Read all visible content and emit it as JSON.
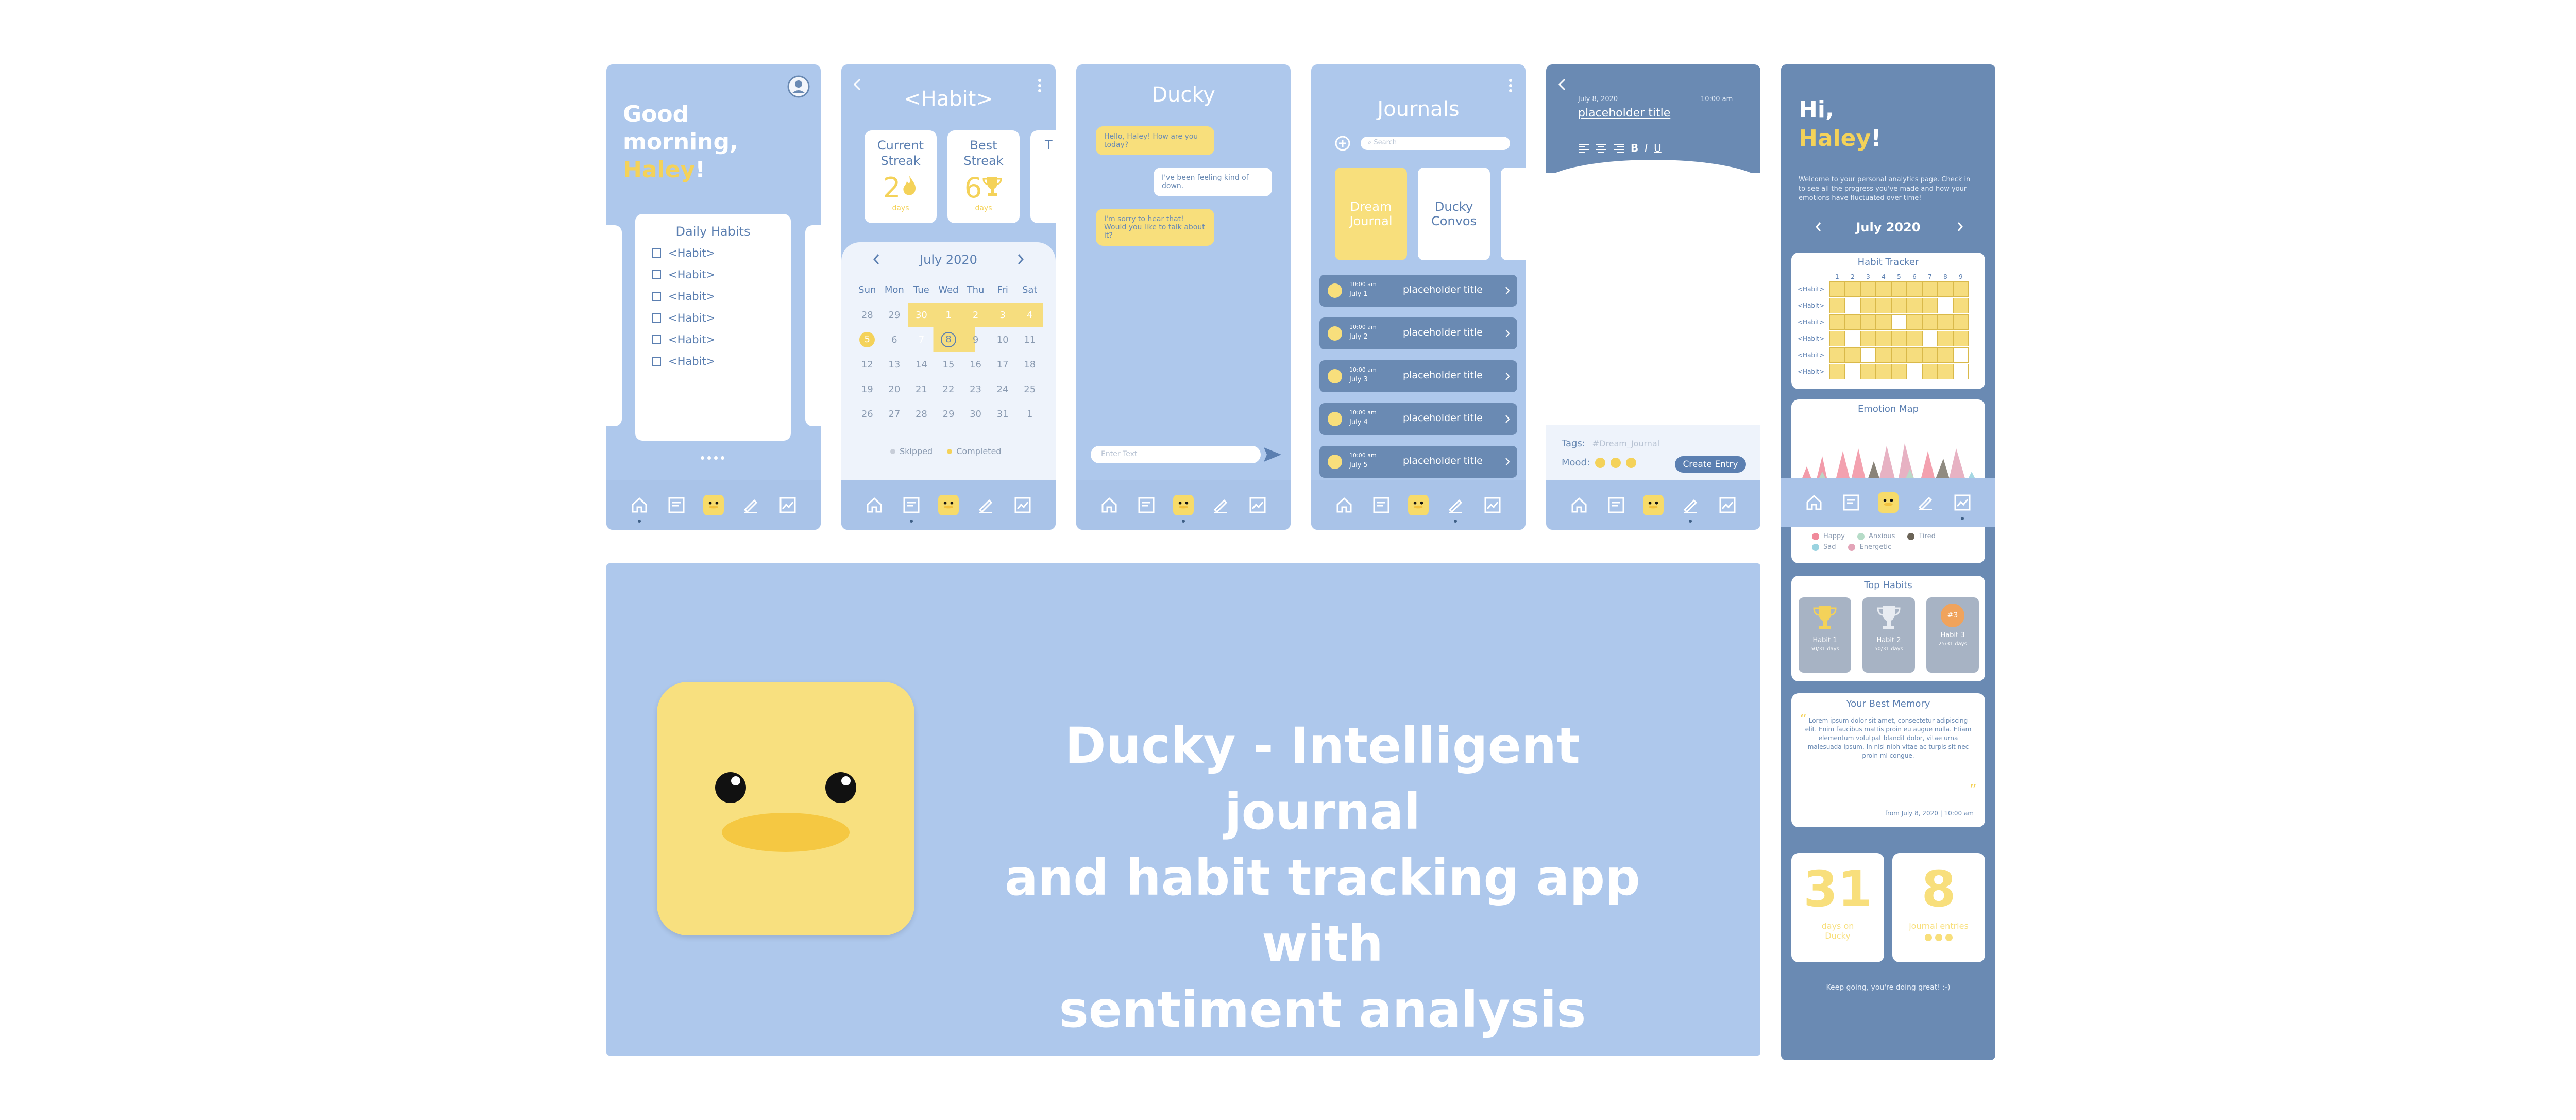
{
  "colors": {
    "light_blue": "#aec8ec",
    "dark_blue": "#6a8ab3",
    "yellow": "#f4d259",
    "navy_text": "#5b7fb1",
    "white": "#ffffff"
  },
  "icons": {
    "nav": [
      "home-icon",
      "stats-icon",
      "duck-icon",
      "pen-icon",
      "chart-icon"
    ],
    "profile": "profile-icon",
    "back": "back-arrow-icon",
    "more": "more-dots-icon"
  },
  "home": {
    "greeting_line1": "Good",
    "greeting_line2": "morning,",
    "name": "Haley",
    "exclaim": "!",
    "daily_habits_title": "Daily Habits",
    "habits": [
      "<Habit>",
      "<Habit>",
      "<Habit>",
      "<Habit>",
      "<Habit>",
      "<Habit>"
    ]
  },
  "habit_detail": {
    "title": "<Habit>",
    "current_streak_label": "Current Streak",
    "current_streak_value": "2",
    "current_streak_unit": "days",
    "best_streak_label": "Best Streak",
    "best_streak_value": "6",
    "best_streak_unit": "days",
    "third_card_letter": "T",
    "month": "July 2020",
    "weekdays": [
      "Sun",
      "Mon",
      "Tue",
      "Wed",
      "Thu",
      "Fri",
      "Sat"
    ],
    "weeks": [
      [
        "28",
        "29",
        "30",
        "1",
        "2",
        "3",
        "4"
      ],
      [
        "5",
        "6",
        "7",
        "8",
        "9",
        "10",
        "11"
      ],
      [
        "12",
        "13",
        "14",
        "15",
        "16",
        "17",
        "18"
      ],
      [
        "19",
        "20",
        "21",
        "22",
        "23",
        "24",
        "25"
      ],
      [
        "26",
        "27",
        "28",
        "29",
        "30",
        "31",
        "1"
      ]
    ],
    "legend_skipped": "Skipped",
    "legend_completed": "Completed"
  },
  "chat": {
    "title": "Ducky",
    "messages": [
      {
        "from": "ducky",
        "text": "Hello, Haley! How are you today?"
      },
      {
        "from": "user",
        "text": "I've been feeling kind of down."
      },
      {
        "from": "ducky",
        "text": "I'm sorry to hear that! Would you like to talk about it?"
      }
    ],
    "input_placeholder": "Enter Text"
  },
  "journals": {
    "title": "Journals",
    "search_placeholder": "Search",
    "cards": [
      "Dream Journal",
      "Ducky Convos"
    ],
    "entries": [
      {
        "time": "10:00 am",
        "date": "July 1",
        "title": "placeholder title"
      },
      {
        "time": "10:00 am",
        "date": "July 2",
        "title": "placeholder title"
      },
      {
        "time": "10:00 am",
        "date": "July 3",
        "title": "placeholder title"
      },
      {
        "time": "10:00 am",
        "date": "July 4",
        "title": "placeholder title"
      },
      {
        "time": "10:00 am",
        "date": "July 5",
        "title": "placeholder title"
      }
    ]
  },
  "editor": {
    "date": "July 8, 2020",
    "time": "10:00 am",
    "title": "placeholder title",
    "toolbar": [
      "align-left-icon",
      "align-center-icon",
      "align-right-icon",
      "B",
      "I",
      "U"
    ],
    "tags_label": "Tags:",
    "tags_placeholder": "#Dream_Journal",
    "mood_label": "Mood:",
    "create_button": "Create Entry"
  },
  "hero": {
    "tagline_line1": "Ducky - Intelligent journal",
    "tagline_line2": "and habit tracking app with",
    "tagline_line3": "sentiment analysis"
  },
  "analytics": {
    "greeting": "Hi,",
    "name": "Haley",
    "exclaim": "!",
    "intro": "Welcome to your personal analytics page. Check in to see all the progress you've made and how your emotions have fluctuated over time!",
    "month": "July 2020",
    "habit_tracker_title": "Habit Tracker",
    "tracker_days": [
      "1",
      "2",
      "3",
      "4",
      "5",
      "6",
      "7",
      "8",
      "9"
    ],
    "tracker_rows": [
      "<Habit>",
      "<Habit>",
      "<Habit>",
      "<Habit>",
      "<Habit>",
      "<Habit>"
    ],
    "tracker_grid": [
      [
        1,
        1,
        1,
        1,
        1,
        1,
        1,
        1,
        1
      ],
      [
        1,
        0,
        1,
        1,
        1,
        1,
        1,
        0,
        1
      ],
      [
        1,
        1,
        1,
        1,
        0,
        1,
        1,
        1,
        1
      ],
      [
        1,
        0,
        1,
        1,
        1,
        1,
        0,
        1,
        1
      ],
      [
        1,
        1,
        0,
        1,
        1,
        1,
        1,
        1,
        0
      ],
      [
        1,
        0,
        1,
        1,
        1,
        0,
        1,
        1,
        0
      ]
    ],
    "emotion_map_title": "Emotion Map",
    "emotion_legend": [
      {
        "label": "Happy",
        "color": "#f08a9b"
      },
      {
        "label": "Anxious",
        "color": "#b6dcc8"
      },
      {
        "label": "Tired",
        "color": "#6b6457"
      },
      {
        "label": "Sad",
        "color": "#9ad3e0"
      },
      {
        "label": "Energetic",
        "color": "#e3a4b8"
      }
    ],
    "top_habits_title": "Top Habits",
    "top_habits": [
      {
        "name": "Habit 1",
        "detail": "50/31 days"
      },
      {
        "name": "Habit 2",
        "detail": "50/31 days"
      },
      {
        "name": "Habit 3",
        "detail": "25/31 days"
      }
    ],
    "top_habit_badge": "#3",
    "best_memory_title": "Your Best Memory",
    "best_memory_text": "Lorem ipsum dolor sit amet, consectetur adipiscing elit. Enim faucibus mattis proin eu augue nulla. Etiam elementum volutpat blandit dolor, vitae urna malesuada ipsum. In nisi nibh vitae ac turpis sit nec proin mi congue.",
    "best_memory_from": "from July 8, 2020 | 10:00 am",
    "days_value": "31",
    "days_label": "days on Ducky",
    "entries_value": "8",
    "entries_label": "journal entries",
    "footer": "Keep going, you're doing great! :-)"
  }
}
